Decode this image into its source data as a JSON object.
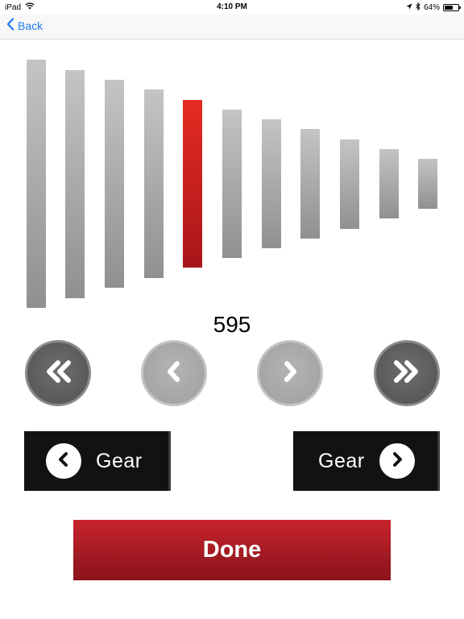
{
  "status_bar": {
    "device": "iPad",
    "time": "4:10 PM",
    "battery_text": "64%",
    "battery_level": 0.64
  },
  "nav": {
    "back_label": "Back",
    "accent_color": "#1e7cf2"
  },
  "selector": {
    "value": "595",
    "bar_count": 11,
    "selected_index": 4,
    "selected_color": "#e52b22"
  },
  "buttons": {
    "gear_down_label": "Gear",
    "gear_up_label": "Gear",
    "done_label": "Done"
  },
  "icons": {
    "back": "chevron-left-icon",
    "fast_back": "double-chevron-left-icon",
    "step_back": "chevron-left-icon",
    "step_forward": "chevron-right-icon",
    "fast_forward": "double-chevron-right-icon",
    "wifi": "wifi-icon",
    "location": "location-arrow-icon",
    "bluetooth": "bluetooth-icon",
    "battery": "battery-icon"
  }
}
